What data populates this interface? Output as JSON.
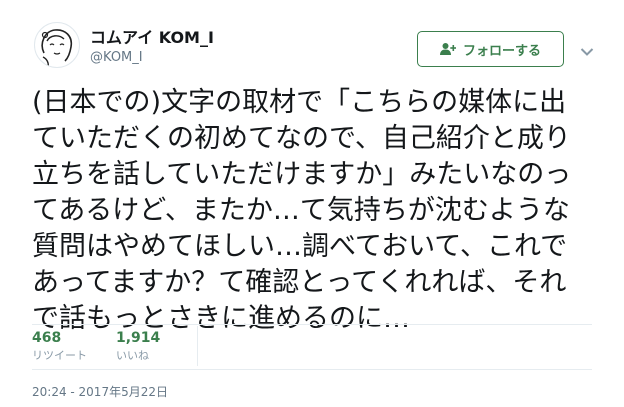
{
  "author": {
    "display_name": "コムアイ KOM_I",
    "handle": "@KOM_I",
    "avatar_icon": "avatar-line-drawing-icon"
  },
  "follow_button": {
    "label": "フォローする",
    "icon": "add-user-icon",
    "color": "#3b7f4d"
  },
  "menu": {
    "icon": "chevron-down-icon"
  },
  "tweet": {
    "lines": [
      "(日本での)文字の取材で「こちらの媒体に出",
      "ていただくの初めてなので、自己紹介と成り",
      "立ちを話していただけますか」みたいなのっ",
      "てあるけど、またか…て気持ちが沈むような",
      "質問はやめてほしい…調べておいて、これで",
      "あってますか？て確認とってくれれば、それ",
      "で話もっとさきに進めるのに…"
    ]
  },
  "stats": {
    "retweets": {
      "count": "468",
      "label": "リツイート"
    },
    "likes": {
      "count": "1,914",
      "label": "いいね"
    }
  },
  "timestamp": "20:24 - 2017年5月22日",
  "colors": {
    "accent": "#3b7f4d",
    "text": "#14171a",
    "secondary": "#657786"
  }
}
